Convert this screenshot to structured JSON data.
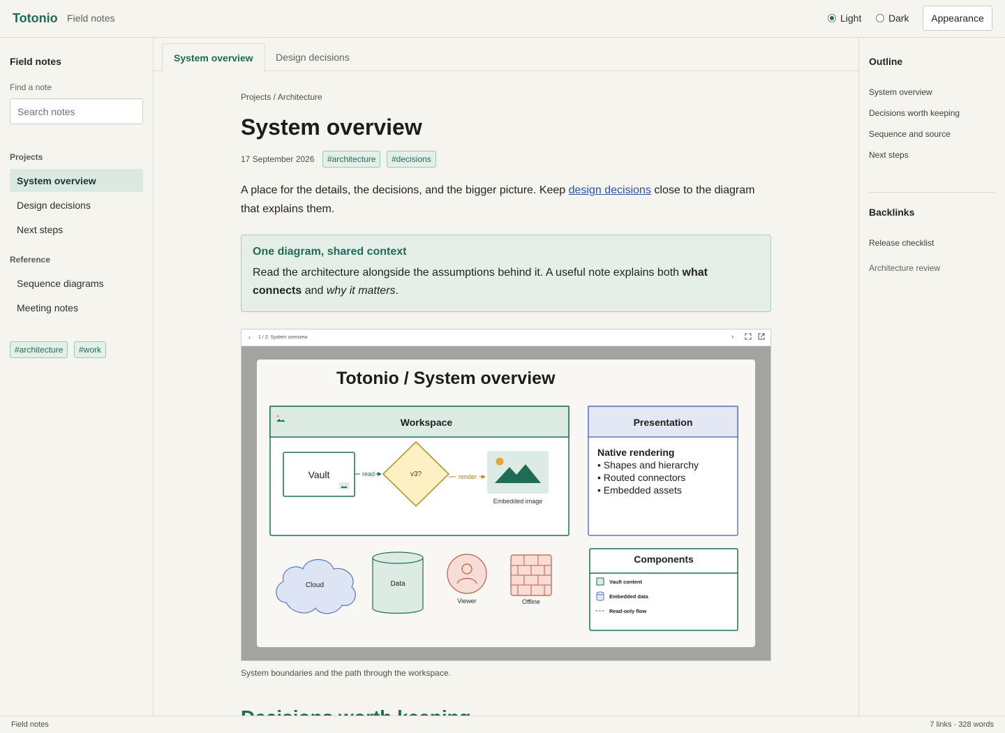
{
  "app": {
    "brand": "Totonio",
    "section": "Field notes"
  },
  "theme": {
    "light_label": "Light",
    "dark_label": "Dark",
    "selected": "Light",
    "appearance_label": "Appearance"
  },
  "sidebar": {
    "title": "Field notes",
    "search_label": "Find a note",
    "search_placeholder": "Search notes",
    "projects_heading": "Projects",
    "projects": [
      {
        "label": "System overview",
        "active": true
      },
      {
        "label": "Design decisions",
        "active": false
      },
      {
        "label": "Next steps",
        "active": false
      }
    ],
    "reference_heading": "Reference",
    "reference": [
      {
        "label": "Sequence diagrams"
      },
      {
        "label": "Meeting notes"
      }
    ],
    "tags": [
      "#architecture",
      "#work"
    ]
  },
  "tabs": [
    {
      "label": "System overview",
      "active": true
    },
    {
      "label": "Design decisions",
      "active": false
    }
  ],
  "note": {
    "breadcrumb": "Projects / Architecture",
    "title": "System overview",
    "date": "17 September 2026",
    "tags": [
      "#architecture",
      "#decisions"
    ],
    "intro_before": "A place for the details, the decisions, and the bigger picture. Keep ",
    "intro_link": "design decisions",
    "intro_after": " close to the diagram that explains them.",
    "callout_title": "One diagram, shared context",
    "callout_before": "Read the architecture alongside the assumptions behind it. A useful note explains both ",
    "callout_bold": "what connects",
    "callout_mid": " and ",
    "callout_italic": "why it matters",
    "callout_after": ".",
    "caption": "System boundaries and the path through the workspace.",
    "next_heading": "Decisions worth keeping"
  },
  "viewer": {
    "label": "1 / 2: System overview"
  },
  "diagram": {
    "title": "Totonio / System overview",
    "workspace": "Workspace",
    "vault": "Vault",
    "read": "read",
    "decision": "v3?",
    "render": "render",
    "embedded_image": "Embedded image",
    "presentation": "Presentation",
    "native_rendering": "Native rendering",
    "bullets": [
      "• Shapes and hierarchy",
      "• Routed connectors",
      "• Embedded assets"
    ],
    "cloud": "Cloud",
    "data": "Data",
    "viewer": "Viewer",
    "offline": "Offline",
    "components": "Components",
    "legend": [
      "Vault content",
      "Embedded data",
      "Read-only flow"
    ]
  },
  "outline": {
    "heading": "Outline",
    "items": [
      "System overview",
      "Decisions worth keeping",
      "Sequence and source",
      "Next steps"
    ]
  },
  "backlinks": {
    "heading": "Backlinks",
    "items": [
      "Release checklist",
      "Architecture review"
    ]
  },
  "status": {
    "left": "Field notes",
    "right": "7 links · 328 words"
  },
  "colors": {
    "accent": "#1f6b55",
    "link": "#2f4fa3",
    "callout_bg": "#e6eee8",
    "background": "#f5f4ef"
  }
}
